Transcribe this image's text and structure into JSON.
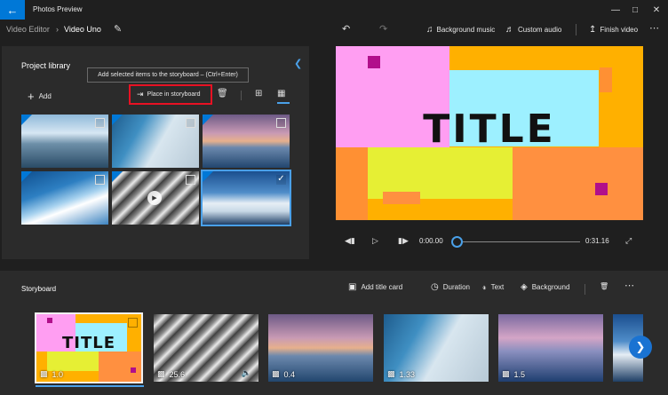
{
  "app": {
    "title": "Photos Preview",
    "back_icon": "arrow-left-icon",
    "accent_color": "#0078d7"
  },
  "header": {
    "breadcrumb": [
      "Video Editor",
      "Video Uno"
    ],
    "crumb_separator": "›",
    "undo_icon": "undo-icon",
    "redo_icon": "redo-icon",
    "background_music_label": "Background music",
    "custom_audio_label": "Custom audio",
    "finish_video_label": "Finish video"
  },
  "library": {
    "title": "Project library",
    "tooltip": "Add selected items to the storyboard – (Ctrl+Enter)",
    "add_label": "Add",
    "place_label": "Place in storyboard",
    "highlight_color": "#e81123",
    "items": [
      {
        "kind": "glacier",
        "selected": false
      },
      {
        "kind": "ice-wall",
        "selected": false
      },
      {
        "kind": "sunset-iceberg",
        "selected": false
      },
      {
        "kind": "blue-iceberg",
        "selected": false
      },
      {
        "kind": "video-river",
        "selected": false
      },
      {
        "kind": "snow-mountain",
        "selected": true
      }
    ]
  },
  "preview": {
    "title_text": "TITLE",
    "current_time": "0:00.00",
    "total_time": "0:31.16"
  },
  "storyboard": {
    "title": "Storyboard",
    "add_title_card_label": "Add title card",
    "duration_label": "Duration",
    "text_label": "Text",
    "background_label": "Background",
    "cards": [
      {
        "duration": "1.0",
        "type": "title"
      },
      {
        "duration": "25.6",
        "type": "video"
      },
      {
        "duration": "0.4",
        "type": "photo"
      },
      {
        "duration": "1.33",
        "type": "photo"
      },
      {
        "duration": "1.5",
        "type": "photo"
      },
      {
        "duration": "",
        "type": "photo"
      }
    ],
    "card_title_text": "TITLE"
  }
}
